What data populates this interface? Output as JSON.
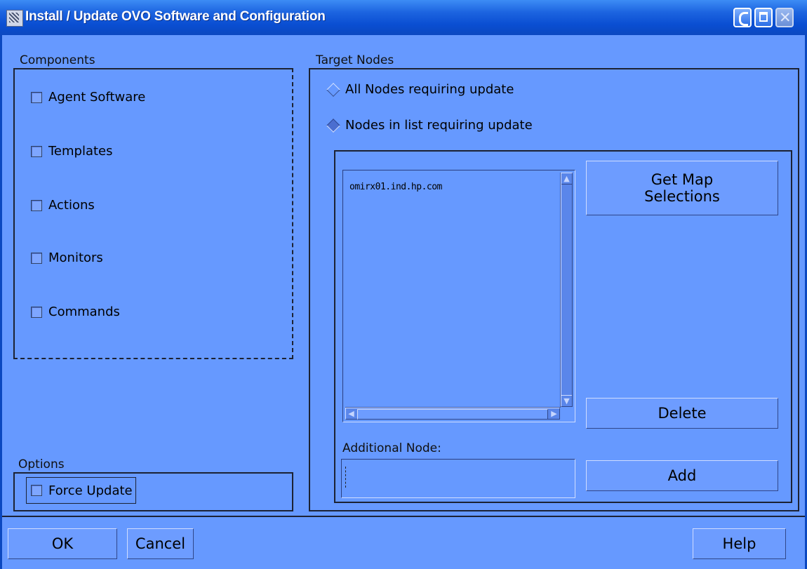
{
  "window": {
    "title": "Install / Update OVO Software and Configuration",
    "icon": "app-icon",
    "controls": [
      "minimize-icon",
      "maximize-icon",
      "close-icon"
    ]
  },
  "components": {
    "label": "Components",
    "items": [
      {
        "label": "Agent Software",
        "checked": false
      },
      {
        "label": "Templates",
        "checked": false
      },
      {
        "label": "Actions",
        "checked": false
      },
      {
        "label": "Monitors",
        "checked": false
      },
      {
        "label": "Commands",
        "checked": false
      }
    ]
  },
  "options": {
    "label": "Options",
    "force_update": {
      "label": "Force Update",
      "checked": false
    }
  },
  "target": {
    "label": "Target Nodes",
    "radio_all": {
      "label": "All Nodes requiring update",
      "selected": false
    },
    "radio_list": {
      "label": "Nodes in list requiring update",
      "selected": true
    },
    "nodes": [
      "omirx01.ind.hp.com"
    ],
    "get_map_line1": "Get Map",
    "get_map_line2": "Selections",
    "delete_label": "Delete",
    "additional_label": "Additional Node:",
    "additional_value": "",
    "add_label": "Add"
  },
  "footer": {
    "ok": "OK",
    "cancel": "Cancel",
    "help": "Help"
  },
  "colors": {
    "background": "#6699ff",
    "titlebar": "#0a4ed2"
  }
}
